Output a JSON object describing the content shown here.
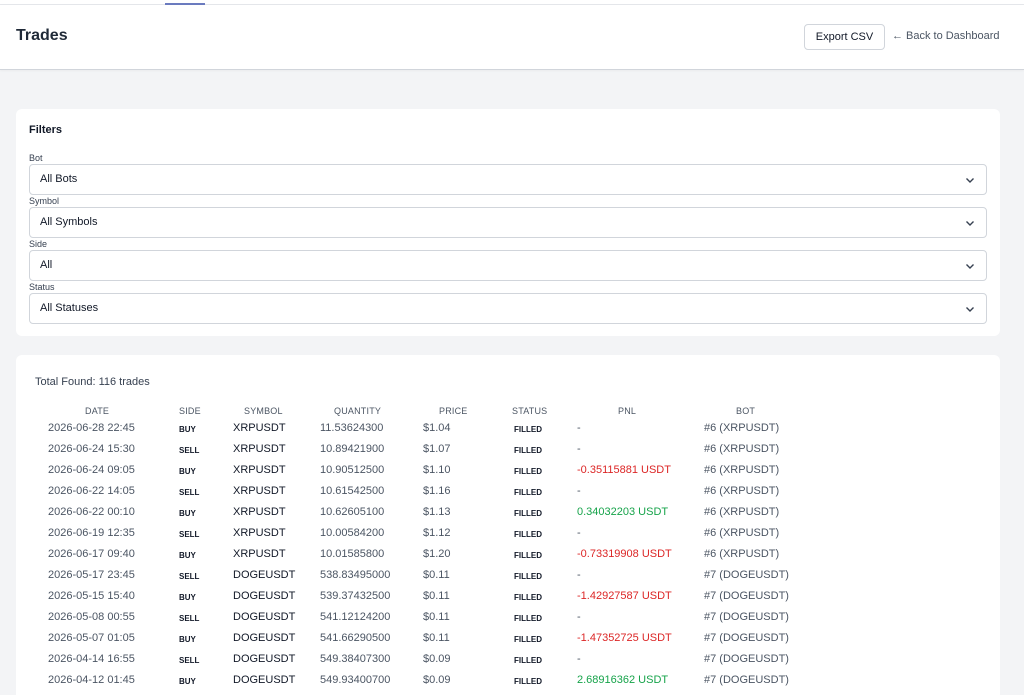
{
  "header": {
    "title": "Trades",
    "export_label": "Export CSV",
    "back_arrow": "←",
    "back_label": "Back to Dashboard"
  },
  "filters": {
    "title": "Filters",
    "fields": [
      {
        "label": "Bot",
        "value": "All Bots"
      },
      {
        "label": "Symbol",
        "value": "All Symbols"
      },
      {
        "label": "Side",
        "value": "All"
      },
      {
        "label": "Status",
        "value": "All Statuses"
      }
    ]
  },
  "results": {
    "total_label": "Total Found: 116 trades",
    "columns": [
      "DATE",
      "SIDE",
      "SYMBOL",
      "QUANTITY",
      "PRICE",
      "STATUS",
      "PNL",
      "BOT"
    ],
    "rows": [
      {
        "date": "2026-06-28 22:45",
        "side": "BUY",
        "symbol": "XRPUSDT",
        "quantity": "11.53624300",
        "price": "$1.04",
        "status": "FILLED",
        "pnl": "-",
        "pnl_sign": "none",
        "bot": "#6 (XRPUSDT)"
      },
      {
        "date": "2026-06-24 15:30",
        "side": "SELL",
        "symbol": "XRPUSDT",
        "quantity": "10.89421900",
        "price": "$1.07",
        "status": "FILLED",
        "pnl": "-",
        "pnl_sign": "none",
        "bot": "#6 (XRPUSDT)"
      },
      {
        "date": "2026-06-24 09:05",
        "side": "BUY",
        "symbol": "XRPUSDT",
        "quantity": "10.90512500",
        "price": "$1.10",
        "status": "FILLED",
        "pnl": "-0.35115881 USDT",
        "pnl_sign": "neg",
        "bot": "#6 (XRPUSDT)"
      },
      {
        "date": "2026-06-22 14:05",
        "side": "SELL",
        "symbol": "XRPUSDT",
        "quantity": "10.61542500",
        "price": "$1.16",
        "status": "FILLED",
        "pnl": "-",
        "pnl_sign": "none",
        "bot": "#6 (XRPUSDT)"
      },
      {
        "date": "2026-06-22 00:10",
        "side": "BUY",
        "symbol": "XRPUSDT",
        "quantity": "10.62605100",
        "price": "$1.13",
        "status": "FILLED",
        "pnl": "0.34032203 USDT",
        "pnl_sign": "pos",
        "bot": "#6 (XRPUSDT)"
      },
      {
        "date": "2026-06-19 12:35",
        "side": "SELL",
        "symbol": "XRPUSDT",
        "quantity": "10.00584200",
        "price": "$1.12",
        "status": "FILLED",
        "pnl": "-",
        "pnl_sign": "none",
        "bot": "#6 (XRPUSDT)"
      },
      {
        "date": "2026-06-17 09:40",
        "side": "BUY",
        "symbol": "XRPUSDT",
        "quantity": "10.01585800",
        "price": "$1.20",
        "status": "FILLED",
        "pnl": "-0.73319908 USDT",
        "pnl_sign": "neg",
        "bot": "#6 (XRPUSDT)"
      },
      {
        "date": "2026-05-17 23:45",
        "side": "SELL",
        "symbol": "DOGEUSDT",
        "quantity": "538.83495000",
        "price": "$0.11",
        "status": "FILLED",
        "pnl": "-",
        "pnl_sign": "none",
        "bot": "#7 (DOGEUSDT)"
      },
      {
        "date": "2026-05-15 15:40",
        "side": "BUY",
        "symbol": "DOGEUSDT",
        "quantity": "539.37432500",
        "price": "$0.11",
        "status": "FILLED",
        "pnl": "-1.42927587 USDT",
        "pnl_sign": "neg",
        "bot": "#7 (DOGEUSDT)"
      },
      {
        "date": "2026-05-08 00:55",
        "side": "SELL",
        "symbol": "DOGEUSDT",
        "quantity": "541.12124200",
        "price": "$0.11",
        "status": "FILLED",
        "pnl": "-",
        "pnl_sign": "none",
        "bot": "#7 (DOGEUSDT)"
      },
      {
        "date": "2026-05-07 01:05",
        "side": "BUY",
        "symbol": "DOGEUSDT",
        "quantity": "541.66290500",
        "price": "$0.11",
        "status": "FILLED",
        "pnl": "-1.47352725 USDT",
        "pnl_sign": "neg",
        "bot": "#7 (DOGEUSDT)"
      },
      {
        "date": "2026-04-14 16:55",
        "side": "SELL",
        "symbol": "DOGEUSDT",
        "quantity": "549.38407300",
        "price": "$0.09",
        "status": "FILLED",
        "pnl": "-",
        "pnl_sign": "none",
        "bot": "#7 (DOGEUSDT)"
      },
      {
        "date": "2026-04-12 01:45",
        "side": "BUY",
        "symbol": "DOGEUSDT",
        "quantity": "549.93400700",
        "price": "$0.09",
        "status": "FILLED",
        "pnl": "2.68916362 USDT",
        "pnl_sign": "pos",
        "bot": "#7 (DOGEUSDT)"
      }
    ]
  },
  "colors": {
    "pnl_negative": "#dc2626",
    "pnl_positive": "#16a34a"
  }
}
